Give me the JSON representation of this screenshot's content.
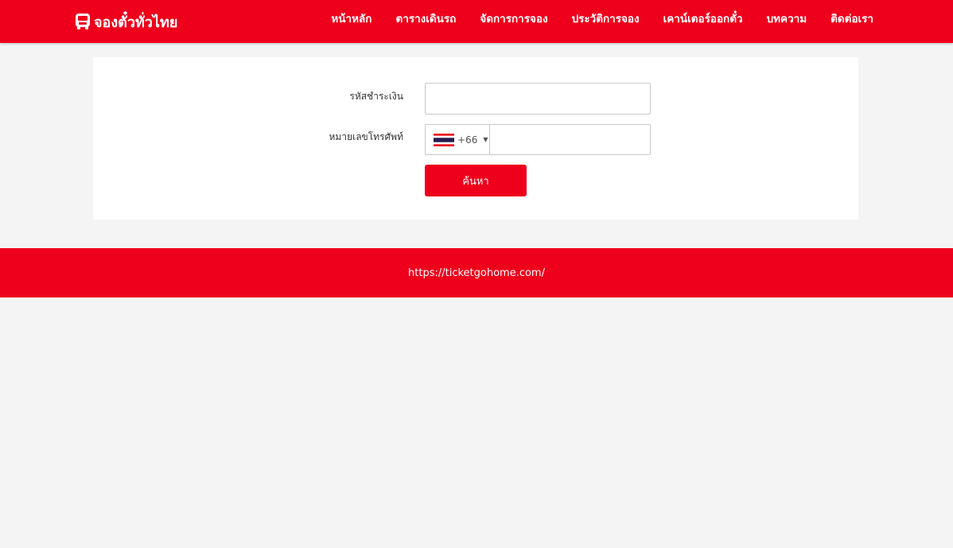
{
  "brand": {
    "name": "จองตั๋วทั่วไทย",
    "icon": "bus-icon",
    "color": "#ee001c"
  },
  "nav": {
    "items": [
      {
        "label": "หน้าหลัก"
      },
      {
        "label": "ตารางเดินรถ"
      },
      {
        "label": "จัดการการจอง"
      },
      {
        "label": "ประวัติการจอง"
      },
      {
        "label": "เคาน์เตอร์ออกตั๋ว"
      },
      {
        "label": "บทความ"
      },
      {
        "label": "ติดต่อเรา"
      }
    ]
  },
  "form": {
    "payment_code_label": "รหัสชำระเงิน",
    "payment_code_value": "",
    "phone_label": "หมายเลขโทรศัพท์",
    "phone_country_flag": "thailand-flag-icon",
    "phone_dial_code": "+66",
    "phone_value": "",
    "search_button": "ค้นหา"
  },
  "footer": {
    "url": "https://ticketgohome.com/"
  }
}
